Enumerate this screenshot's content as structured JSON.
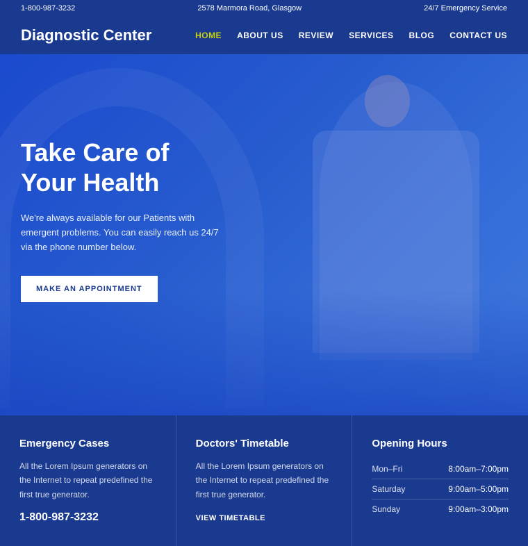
{
  "topbar": {
    "phone": "1-800-987-3232",
    "address": "2578 Marmora Road, Glasgow",
    "emergency": "24/7 Emergency Service"
  },
  "header": {
    "logo": "Diagnostic Center",
    "nav": [
      {
        "label": "HOME",
        "active": true
      },
      {
        "label": "ABOUT US",
        "active": false
      },
      {
        "label": "REVIEW",
        "active": false
      },
      {
        "label": "SERVICES",
        "active": false
      },
      {
        "label": "BLOG",
        "active": false
      },
      {
        "label": "CONTACT US",
        "active": false
      }
    ]
  },
  "hero": {
    "title": "Take Care of Your Health",
    "description": "We're always available for our Patients with emergent problems. You can easily reach us 24/7 via the phone number below.",
    "button": "MAKE AN APPOINTMENT"
  },
  "info": {
    "emergency": {
      "title": "Emergency Cases",
      "text": "All the Lorem Ipsum generators on the Internet to repeat predefined the first true generator.",
      "phone": "1-800-987-3232"
    },
    "timetable": {
      "title": "Doctors' Timetable",
      "text": "All the Lorem Ipsum generators on the Internet to repeat predefined the first true generator.",
      "link": "VIEW TIMETABLE"
    },
    "hours": {
      "title": "Opening Hours",
      "rows": [
        {
          "day": "Mon–Fri",
          "time": "8:00am–7:00pm"
        },
        {
          "day": "Saturday",
          "time": "9:00am–5:00pm"
        },
        {
          "day": "Sunday",
          "time": "9:00am–3:00pm"
        }
      ]
    }
  }
}
